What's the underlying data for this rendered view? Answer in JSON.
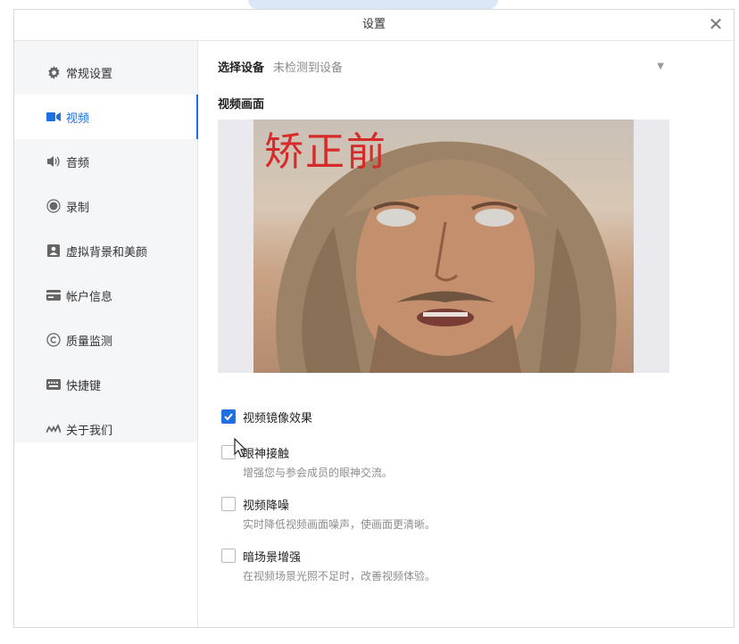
{
  "window": {
    "title": "设置"
  },
  "sidebar": {
    "items": [
      {
        "label": "常规设置",
        "icon": "gear-icon"
      },
      {
        "label": "视频",
        "icon": "video-icon",
        "active": true
      },
      {
        "label": "音频",
        "icon": "speaker-icon"
      },
      {
        "label": "录制",
        "icon": "record-icon"
      },
      {
        "label": "虚拟背景和美颜",
        "icon": "portrait-icon"
      },
      {
        "label": "帐户信息",
        "icon": "card-icon"
      },
      {
        "label": "质量监测",
        "icon": "monitor-icon"
      },
      {
        "label": "快捷键",
        "icon": "keyboard-icon"
      },
      {
        "label": "关于我们",
        "icon": "about-icon"
      }
    ]
  },
  "device": {
    "label": "选择设备",
    "value": "未检测到设备"
  },
  "preview": {
    "label": "视频画面",
    "overlay_text": "矫正前"
  },
  "options": [
    {
      "title": "视频镜像效果",
      "desc": "",
      "checked": true
    },
    {
      "title": "眼神接触",
      "desc": "增强您与参会成员的眼神交流。",
      "checked": false
    },
    {
      "title": "视频降噪",
      "desc": "实时降低视频画面噪声，使画面更清晰。",
      "checked": false
    },
    {
      "title": "暗场景增强",
      "desc": "在视频场景光照不足时，改善视频体验。",
      "checked": false
    }
  ],
  "colors": {
    "accent": "#1e6fe0",
    "overlay_text": "#d52b2b"
  }
}
